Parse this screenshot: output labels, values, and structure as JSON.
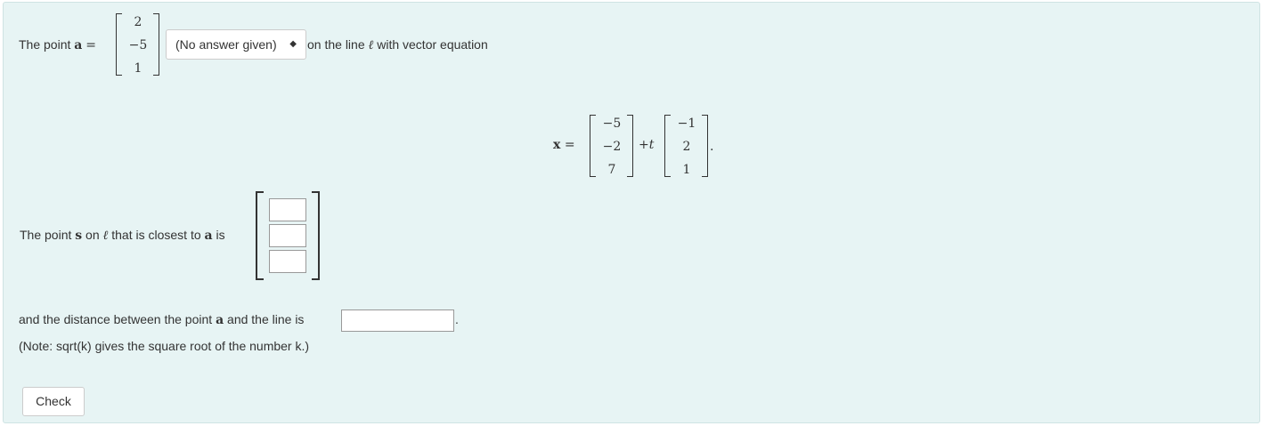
{
  "question": {
    "point_intro": "The point",
    "point_var": "a",
    "equals": "=",
    "point_a": [
      "2",
      "−5",
      "1"
    ],
    "select": {
      "value": "(No answer given)",
      "arrow": "◆"
    },
    "line_text_prefix": "on the line",
    "ell": "ℓ",
    "line_text_suffix": "with vector equation",
    "equation": {
      "lhs": "x",
      "equals": "=",
      "base_point": [
        "−5",
        "−2",
        "7"
      ],
      "plus_t": "+t",
      "direction": [
        "−1",
        "2",
        "1"
      ],
      "period": "."
    },
    "closest": {
      "prefix": "The point",
      "var_s": "s",
      "on": "on",
      "ell": "ℓ",
      "middle": "that is closest to",
      "var_a": "a",
      "is": "is"
    },
    "distance": {
      "prefix": "and the distance between the point",
      "var_a": "a",
      "suffix": "and the line is",
      "period": "."
    },
    "note": "(Note: sqrt(k) gives the square root of the number k.)"
  },
  "check_button": "Check"
}
